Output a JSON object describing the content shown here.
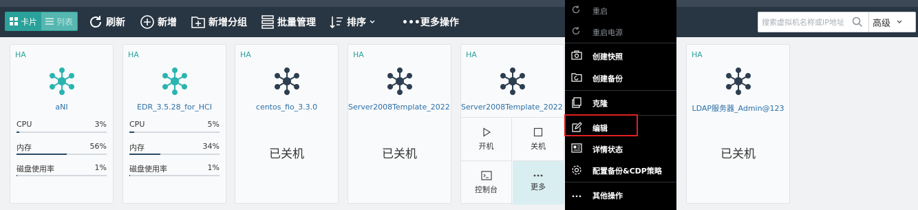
{
  "toolbar": {
    "view_card": "卡片",
    "view_list": "列表",
    "refresh": "刷新",
    "add": "新增",
    "add_group": "新增分组",
    "batch": "批量管理",
    "sort": "排序",
    "more_ops": "•••更多操作",
    "search_placeholder": "搜索虚拟机名称或IP地址",
    "advanced": "高级"
  },
  "vms": [
    {
      "ha": "HA",
      "name": "aNI",
      "status": "running",
      "cpu_label": "CPU",
      "cpu": "3%",
      "mem_label": "内存",
      "mem": "56%",
      "disk_label": "磁盘使用率",
      "disk": "1%",
      "cpu_frac": 0.03,
      "mem_frac": 0.56,
      "disk_frac": 0.01
    },
    {
      "ha": "HA",
      "name": "EDR_3.5.28_for_HCI",
      "status": "running",
      "cpu_label": "CPU",
      "cpu": "5%",
      "mem_label": "内存",
      "mem": "34%",
      "disk_label": "磁盘使用率",
      "disk": "1%",
      "cpu_frac": 0.05,
      "mem_frac": 0.34,
      "disk_frac": 0.01
    },
    {
      "ha": "HA",
      "name": "centos_fio_3.3.0",
      "status": "off",
      "off_text": "已关机"
    },
    {
      "ha": "HA",
      "name": "Server2008Template_2022...",
      "status": "off",
      "off_text": "已关机"
    },
    {
      "ha": "HA",
      "name": "Server2008Template_2022...",
      "status": "hover",
      "actions": {
        "power_on": "开机",
        "shutdown": "关机",
        "console": "控制台",
        "more": "更多"
      }
    },
    {
      "ha": "HA",
      "name": "LDAP服务器_Admin@123",
      "status": "off",
      "off_text": "已关机"
    }
  ],
  "context_menu": {
    "restart": "重启",
    "power_restart": "重启电源",
    "snapshot": "创建快照",
    "backup": "创建备份",
    "clone": "克隆",
    "edit": "编辑",
    "details": "详情状态",
    "backup_cdp": "配置备份&CDP策略",
    "other": "其他操作"
  },
  "colors": {
    "toolbar_bg": "#283542",
    "accent": "#2aa19a",
    "running_icon": "#2ab4b0",
    "off_icon": "#2d3e50",
    "menu_bg": "#000000",
    "highlight": "#e02020"
  }
}
